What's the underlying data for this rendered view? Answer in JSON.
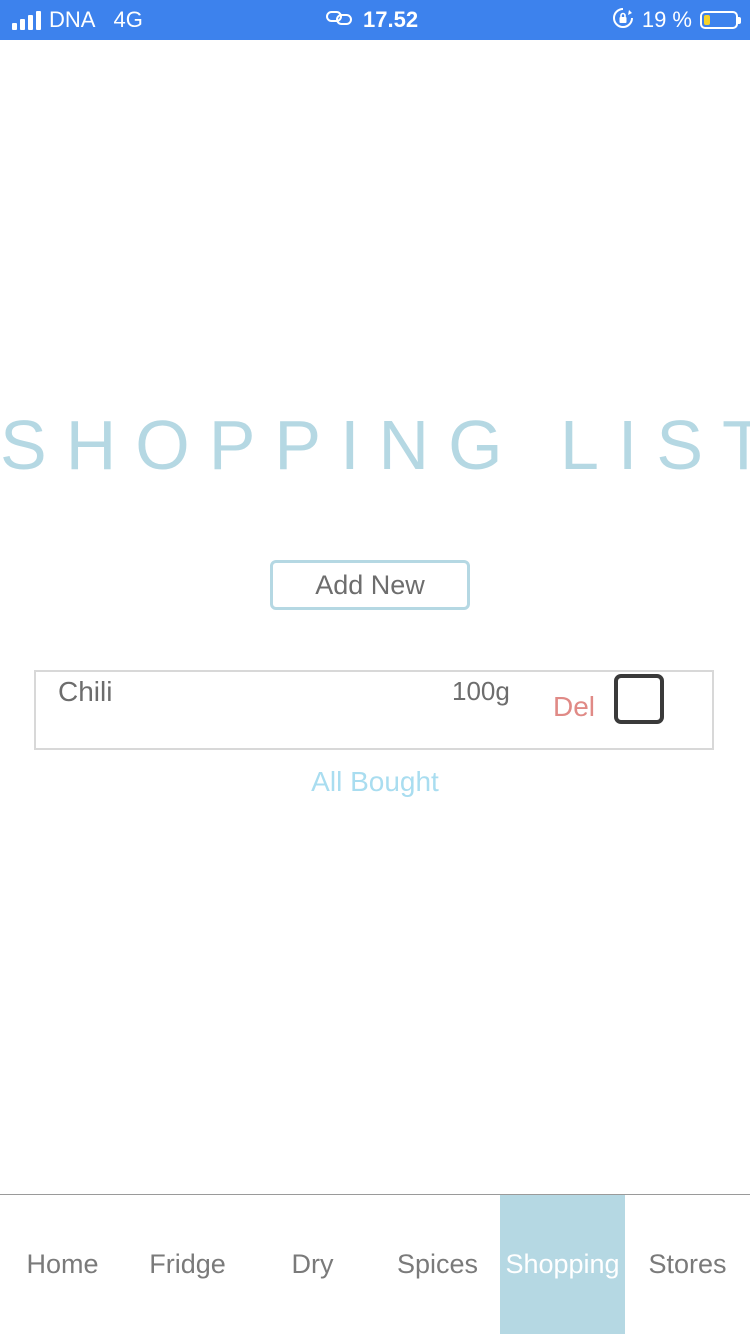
{
  "status_bar": {
    "carrier": "DNA",
    "network": "4G",
    "time": "17.52",
    "battery_percent": "19 %",
    "battery_level": 0.19,
    "icons": [
      "signal-icon",
      "link-icon",
      "rotation-lock-icon",
      "battery-icon"
    ]
  },
  "page": {
    "title": "SHOPPING LIST",
    "add_new_label": "Add New",
    "all_bought_label": "All Bought"
  },
  "items": [
    {
      "name": "Chili",
      "quantity": "100g",
      "delete_label": "Del",
      "checked": false
    }
  ],
  "tabs": [
    {
      "label": "Home",
      "active": false
    },
    {
      "label": "Fridge",
      "active": false
    },
    {
      "label": "Dry",
      "active": false
    },
    {
      "label": "Spices",
      "active": false
    },
    {
      "label": "Shopping",
      "active": true
    },
    {
      "label": "Stores",
      "active": false
    }
  ],
  "colors": {
    "status_bar": "#3d82ed",
    "accent": "#b5d8e3",
    "delete": "#e08a86",
    "link": "#a9ddf0"
  }
}
